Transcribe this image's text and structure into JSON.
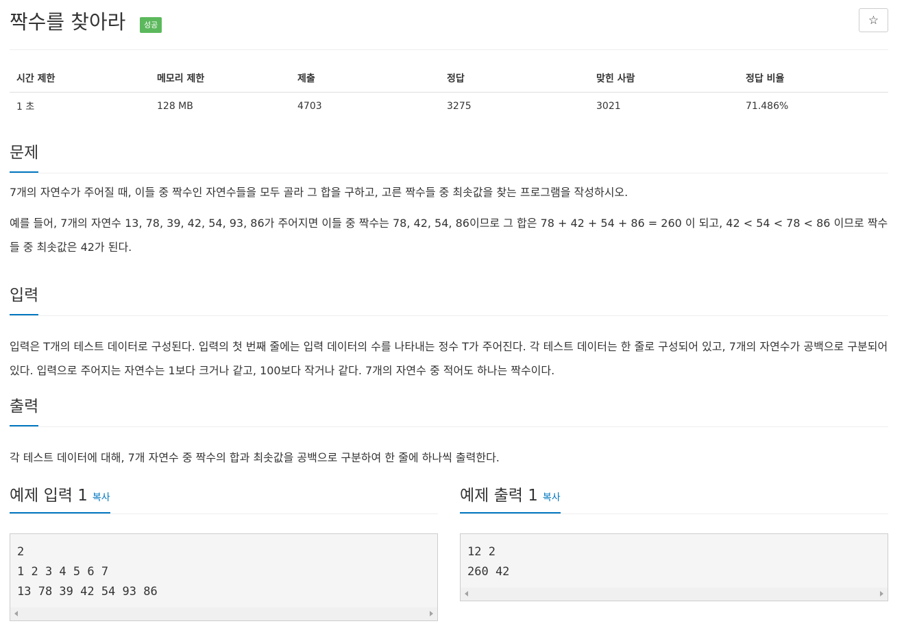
{
  "problem": {
    "title": "짝수를 찾아라",
    "result_badge": "성공",
    "star_icon": "☆"
  },
  "info_table": {
    "headers": [
      "시간 제한",
      "메모리 제한",
      "제출",
      "정답",
      "맞힌 사람",
      "정답 비율"
    ],
    "values": [
      "1 초",
      "128 MB",
      "4703",
      "3275",
      "3021",
      "71.486%"
    ]
  },
  "sections": {
    "description": {
      "title": "문제",
      "paragraphs": [
        "7개의 자연수가 주어질 때, 이들 중 짝수인 자연수들을 모두 골라 그 합을 구하고, 고른 짝수들 중 최솟값을 찾는 프로그램을 작성하시오.",
        "예를 들어, 7개의 자연수 13, 78, 39, 42, 54, 93, 86가 주어지면 이들 중 짝수는 78, 42, 54, 86이므로 그 합은 78 + 42 + 54 + 86 = 260 이 되고, 42 < 54 < 78 < 86 이므로 짝수들 중 최솟값은 42가 된다."
      ]
    },
    "input": {
      "title": "입력",
      "paragraphs": [
        "입력은 T개의 테스트 데이터로 구성된다. 입력의 첫 번째 줄에는 입력 데이터의 수를 나타내는 정수 T가 주어진다. 각 테스트 데이터는 한 줄로 구성되어 있고, 7개의 자연수가 공백으로 구분되어 있다. 입력으로 주어지는 자연수는 1보다 크거나 같고, 100보다 작거나 같다. 7개의 자연수 중 적어도 하나는 짝수이다."
      ]
    },
    "output": {
      "title": "출력",
      "paragraphs": [
        "각 테스트 데이터에 대해, 7개 자연수 중 짝수의 합과 최솟값을 공백으로 구분하여 한 줄에 하나씩 출력한다."
      ]
    }
  },
  "samples": {
    "input": {
      "title": "예제 입력 1",
      "copy_label": "복사",
      "content": "2\n1 2 3 4 5 6 7\n13 78 39 42 54 93 86"
    },
    "output": {
      "title": "예제 출력 1",
      "copy_label": "복사",
      "content": "12 2\n260 42"
    }
  },
  "colors": {
    "accent": "#0076c0",
    "badge_success": "#5cb85c",
    "sample_background": "#f5f5f5"
  }
}
